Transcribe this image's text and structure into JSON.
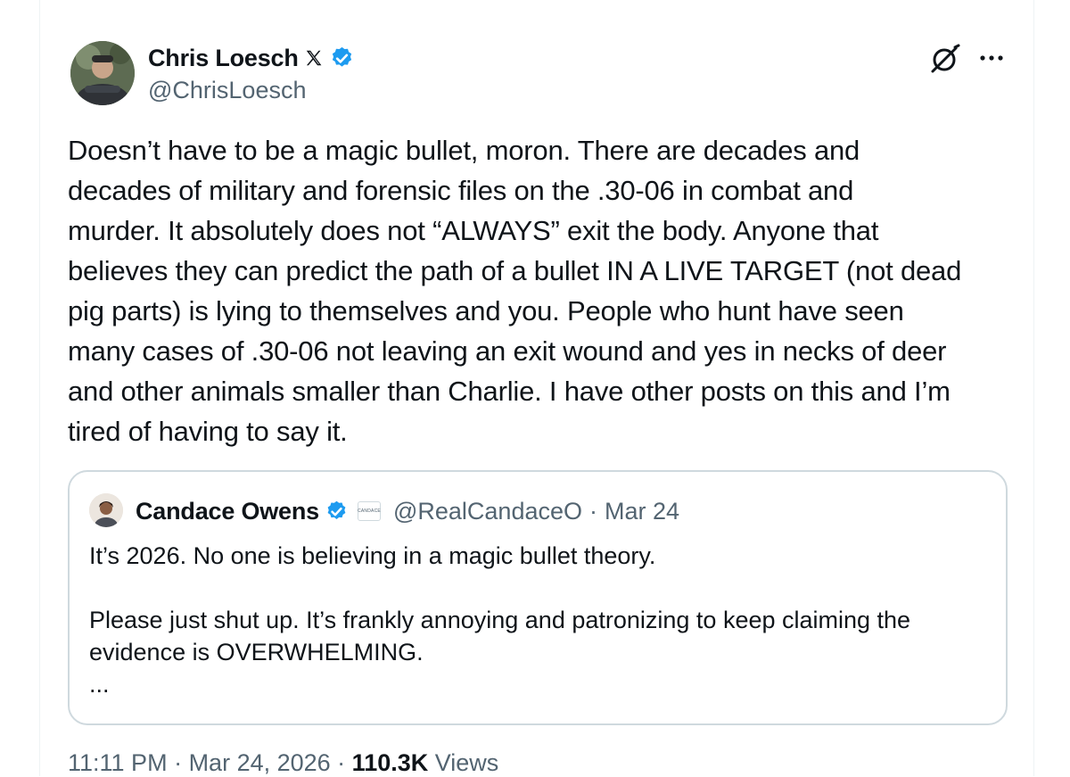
{
  "author": {
    "name": "Chris Loesch",
    "handle": "@ChrisLoesch",
    "verified": true,
    "x_badge_icon": "x-logo-icon"
  },
  "tweet": {
    "lines": [
      "Doesn’t have to be a magic bullet, moron. There are decades and",
      "decades of military and forensic files on the .30-06 in combat and",
      "murder. It absolutely does not “ALWAYS” exit the body. Anyone that",
      "believes they can predict the path of a bullet IN A LIVE TARGET (not dead",
      "pig parts) is lying to themselves and you. People who hunt have seen",
      "many cases of .30-06 not leaving an exit wound and yes in necks of deer",
      "and other animals smaller than Charlie. I have other posts on this and I’m",
      "tired of having to say it."
    ]
  },
  "quoted": {
    "name": "Candace Owens",
    "affiliation_label": "CANDACE",
    "handle": "@RealCandaceO",
    "separator": "·",
    "date": "Mar 24",
    "paragraph1": "It’s 2026. No one is believing in a magic bullet theory.",
    "paragraph2_line1": "Please just shut up. It’s frankly annoying and patronizing to keep claiming the",
    "paragraph2_line2": "evidence is OVERWHELMING.",
    "ellipsis": "..."
  },
  "meta": {
    "time": "11:11 PM",
    "sep1": " · ",
    "date": "Mar 24, 2026",
    "sep2": " · ",
    "views_count": "110.3K",
    "views_label": " Views"
  },
  "colors": {
    "text": "#0f1419",
    "secondary": "#536471",
    "verified_blue": "#1d9bf0",
    "border": "#cfd9de"
  }
}
